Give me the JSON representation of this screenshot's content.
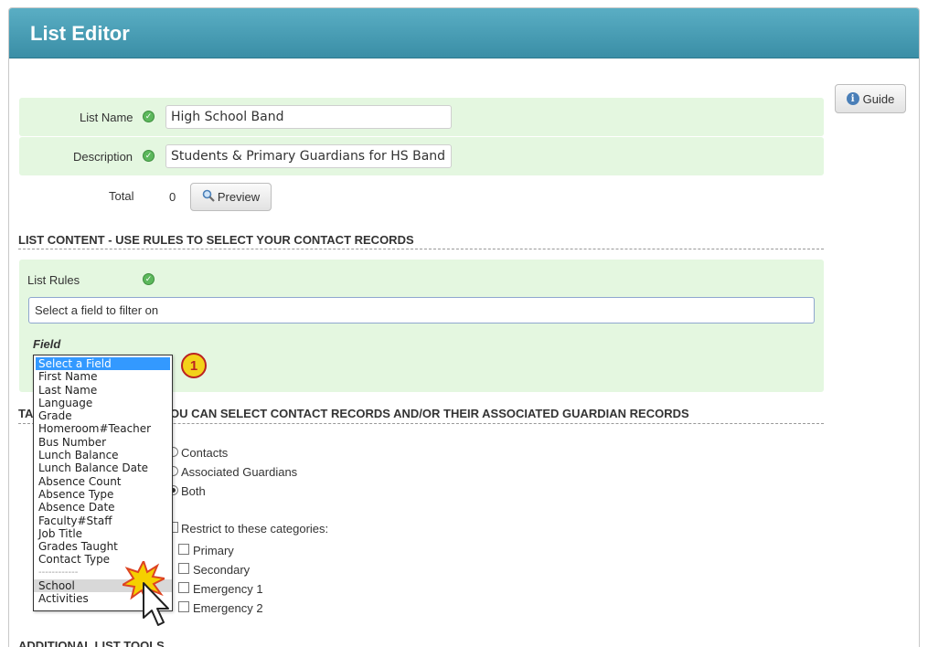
{
  "window": {
    "title": "List Editor"
  },
  "guide_button": {
    "label": "Guide",
    "icon": "info-icon"
  },
  "form": {
    "list_name": {
      "label": "List Name",
      "value": "High School Band"
    },
    "description": {
      "label": "Description",
      "value": "Students & Primary Guardians for HS Band"
    },
    "total": {
      "label": "Total",
      "value": "0"
    },
    "preview_button": {
      "label": "Preview",
      "icon": "magnifier-icon"
    }
  },
  "list_content": {
    "heading": "LIST CONTENT - USE RULES TO SELECT YOUR CONTACT RECORDS",
    "rules_label": "List Rules",
    "filter_input_text": "Select a field to filter on",
    "field_label": "Field",
    "field_options": [
      "Select a Field",
      "First Name",
      "Last Name",
      "Language",
      "Grade",
      "Homeroom#Teacher",
      "Bus Number",
      "Lunch Balance",
      "Lunch Balance Date",
      "Absence Count",
      "Absence Type",
      "Absence Date",
      "Faculty#Staff",
      "Job Title",
      "Grades Taught",
      "Contact Type",
      "------------",
      "School",
      "Activities"
    ],
    "selected_option": "Select a Field",
    "hovered_option": "School",
    "step_badge": "1"
  },
  "target": {
    "heading_visible": "TA",
    "heading_rest": "OU CAN SELECT CONTACT RECORDS AND/OR THEIR ASSOCIATED GUARDIAN RECORDS",
    "radio_options": [
      "Contacts",
      "Associated Guardians",
      "Both"
    ],
    "selected_radio": "Both",
    "restrict_label": "Restrict to these categories:",
    "categories": [
      "Primary",
      "Secondary",
      "Emergency 1",
      "Emergency 2"
    ]
  },
  "additional": {
    "heading": "ADDITIONAL LIST TOOLS"
  },
  "colors": {
    "header": "#3a8ea6",
    "rule_bg": "#e4f7e0",
    "select_highlight": "#3399ff",
    "badge": "#f3d21a"
  }
}
